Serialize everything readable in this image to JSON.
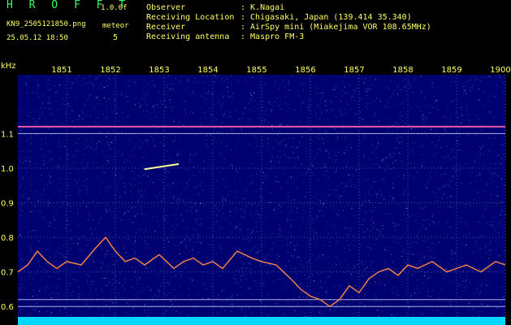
{
  "header": {
    "title": "H R O F F T",
    "version": "1.0.0f",
    "filename": "KN9_2505121850.png",
    "meteor_label": "meteor",
    "datetime": "25.05.12 18:50",
    "meteor_count": "5",
    "fields": [
      {
        "label": "Observer",
        "value": ": K.Nagai"
      },
      {
        "label": "Receiving Location",
        "value": ": Chigasaki, Japan (139.414 35.340)"
      },
      {
        "label": "Receiver",
        "value": ": AirSpy mini (Miakejima VOR 108.65MHz)"
      },
      {
        "label": "Receiving antenna",
        "value": ": Maspro FM-3"
      }
    ]
  },
  "chart_data": {
    "type": "heatmap",
    "ylabel": "kHz",
    "x_ticks": [
      "1851",
      "1852",
      "1853",
      "1854",
      "1855",
      "1856",
      "1857",
      "1858",
      "1859",
      "1900"
    ],
    "y_ticks": [
      "1.1",
      "1.0",
      "0.9",
      "0.8",
      "0.7",
      "0.6"
    ],
    "ylim": [
      0.57,
      1.27
    ],
    "grid": true,
    "carrier_lines_khz": [
      1.12,
      1.1,
      0.62,
      0.6
    ],
    "meteor_trace": {
      "x_start": 1852.6,
      "x_end": 1853.3,
      "y_start": 0.997,
      "y_end": 1.012
    },
    "drift_signal": {
      "x": [
        1850.0,
        1850.2,
        1850.4,
        1850.6,
        1850.8,
        1851.0,
        1851.3,
        1851.6,
        1851.8,
        1852.0,
        1852.2,
        1852.4,
        1852.6,
        1852.9,
        1853.2,
        1853.4,
        1853.6,
        1853.8,
        1854.0,
        1854.2,
        1854.5,
        1854.8,
        1855.0,
        1855.3,
        1855.6,
        1855.8,
        1856.0,
        1856.2,
        1856.4,
        1856.6,
        1856.8,
        1857.0,
        1857.2,
        1857.4,
        1857.6,
        1857.8,
        1858.0,
        1858.2,
        1858.5,
        1858.8,
        1859.0,
        1859.2,
        1859.5,
        1859.8,
        1860.0
      ],
      "y": [
        0.7,
        0.72,
        0.76,
        0.73,
        0.71,
        0.73,
        0.72,
        0.77,
        0.8,
        0.76,
        0.73,
        0.74,
        0.72,
        0.75,
        0.71,
        0.73,
        0.74,
        0.72,
        0.73,
        0.71,
        0.76,
        0.74,
        0.73,
        0.72,
        0.68,
        0.65,
        0.63,
        0.62,
        0.6,
        0.62,
        0.66,
        0.64,
        0.68,
        0.7,
        0.71,
        0.69,
        0.72,
        0.71,
        0.73,
        0.7,
        0.71,
        0.72,
        0.7,
        0.73,
        0.72
      ]
    },
    "colors": {
      "background": "#000070",
      "noise": "#2f6fd0",
      "tick": "#ffff66",
      "carrier": "#ff66aa",
      "signal": "#ff8844",
      "baseline": "#00d8ff"
    }
  }
}
